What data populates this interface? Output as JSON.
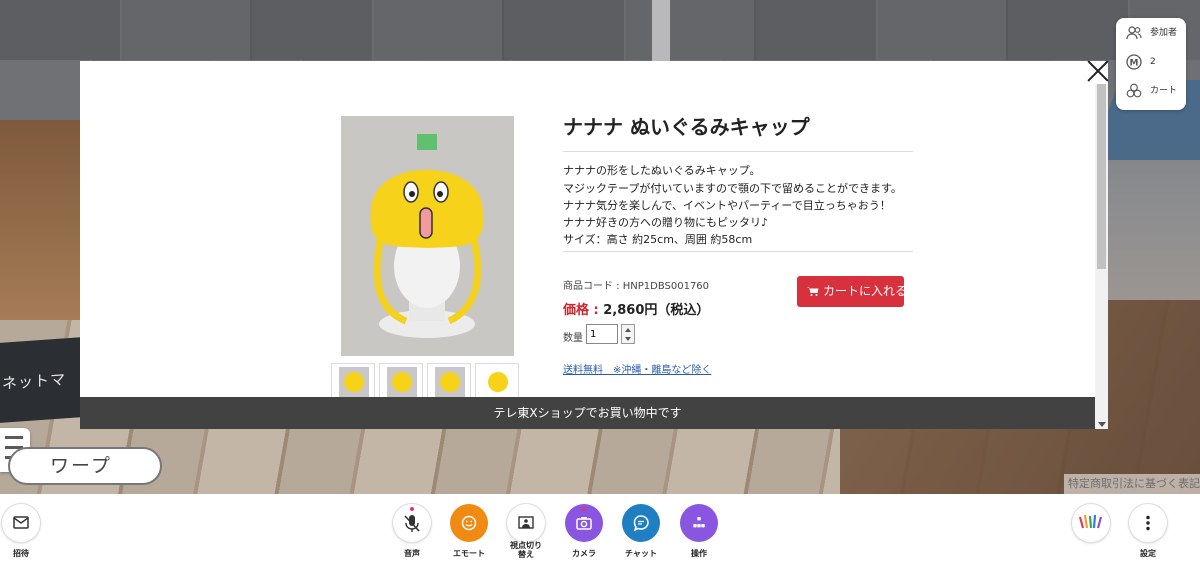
{
  "scene": {
    "shelf_sign": "ネットマ",
    "warp_button": "ワープ",
    "legal_notice": "特定商取引法に基づく表記"
  },
  "side_panel": {
    "participants_label": "参加者",
    "count": "2",
    "cart_label": "カート"
  },
  "product": {
    "title": "ナナナ ぬいぐるみキャップ",
    "description": [
      "ナナナの形をしたぬいぐるみキャップ。",
      "マジックテープが付いていますので顎の下で留めることができます。",
      "ナナナ気分を楽しんで、イベントやパーティーで目立っちゃおう！",
      "ナナナ好きの方への贈り物にもピッタリ♪",
      "サイズ：高さ 約25cm、周囲 約58cm"
    ],
    "code": "商品コード : HNP1DBS001760",
    "price_label": "価格 :",
    "price_value": "2,860円（税込）",
    "quantity_label": "数量",
    "quantity_value": "1",
    "add_to_cart": "カートに入れる",
    "shipping_link": "送料無料　※沖縄・離島など除く"
  },
  "shop_banner": "テレ東Xショップでお買い物中です",
  "toolbar": {
    "invite": "招待",
    "voice": "音声",
    "emote": "エモート",
    "viewpoint": "視点切り\n替え",
    "camera": "カメラ",
    "chat": "チャット",
    "operation": "操作",
    "settings": "設定"
  },
  "colors": {
    "emote": "#f08a12",
    "camera": "#8a55e0",
    "chat": "#1f7fc2",
    "operation": "#8a55e0",
    "cart_button": "#d8313e",
    "price_label": "#d1232a"
  }
}
